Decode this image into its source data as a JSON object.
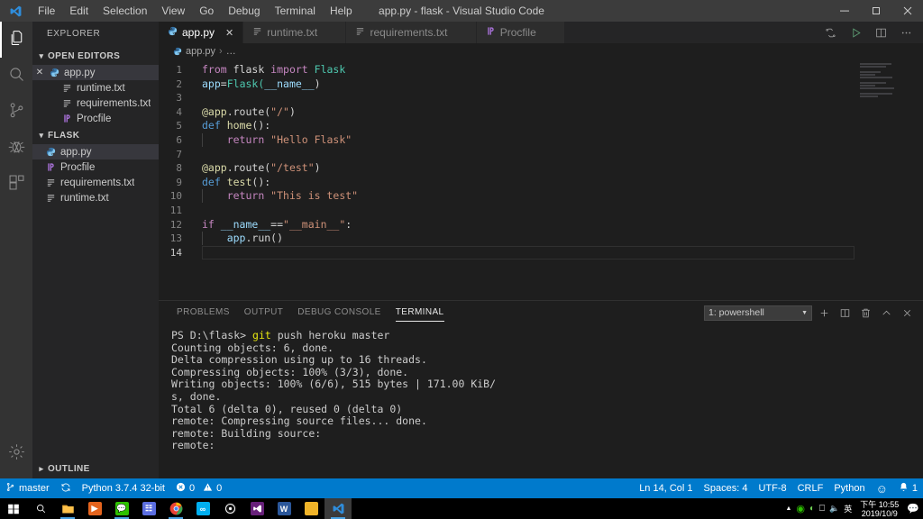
{
  "window": {
    "title": "app.py - flask - Visual Studio Code",
    "minimize_label": "─",
    "maximize_label": "❐",
    "close_label": "✕"
  },
  "menubar": {
    "items": [
      {
        "label": "File"
      },
      {
        "label": "Edit"
      },
      {
        "label": "Selection"
      },
      {
        "label": "View"
      },
      {
        "label": "Go"
      },
      {
        "label": "Debug"
      },
      {
        "label": "Terminal"
      },
      {
        "label": "Help"
      }
    ]
  },
  "activitybar": {
    "items": [
      {
        "name": "explorer",
        "icon": "files-icon",
        "active": true
      },
      {
        "name": "search",
        "icon": "search-icon",
        "active": false
      },
      {
        "name": "source-control",
        "icon": "source-control-icon",
        "active": false
      },
      {
        "name": "debug",
        "icon": "debug-icon",
        "active": false
      },
      {
        "name": "extensions",
        "icon": "extensions-icon",
        "active": false
      }
    ],
    "settings_icon": "gear-icon"
  },
  "sidebar": {
    "title": "EXPLORER",
    "open_editors": {
      "header": "OPEN EDITORS",
      "items": [
        {
          "label": "app.py",
          "icon": "python-icon",
          "selected": true,
          "has_close": true,
          "indent": 0
        },
        {
          "label": "runtime.txt",
          "icon": "text-icon",
          "selected": false,
          "has_close": false,
          "indent": 1
        },
        {
          "label": "requirements.txt",
          "icon": "text-icon",
          "selected": false,
          "has_close": false,
          "indent": 1
        },
        {
          "label": "Procfile",
          "icon": "procfile-icon",
          "selected": false,
          "has_close": false,
          "indent": 1
        }
      ]
    },
    "folder": {
      "header": "FLASK",
      "items": [
        {
          "label": "app.py",
          "icon": "python-icon",
          "selected": true
        },
        {
          "label": "Procfile",
          "icon": "procfile-icon",
          "selected": false
        },
        {
          "label": "requirements.txt",
          "icon": "text-icon",
          "selected": false
        },
        {
          "label": "runtime.txt",
          "icon": "text-icon",
          "selected": false
        }
      ]
    },
    "outline": {
      "header": "OUTLINE"
    }
  },
  "editor": {
    "tabs": [
      {
        "label": "app.py",
        "icon": "python-icon",
        "active": true
      },
      {
        "label": "runtime.txt",
        "icon": "text-icon",
        "active": false
      },
      {
        "label": "requirements.txt",
        "icon": "text-icon",
        "active": false
      },
      {
        "label": "Procfile",
        "icon": "procfile-icon",
        "active": false
      }
    ],
    "tab_close_label": "✕",
    "actions": [
      {
        "name": "run-tests-icon",
        "glyph": "⇅"
      },
      {
        "name": "run-python-file-icon",
        "glyph": "▷"
      },
      {
        "name": "split-editor-icon",
        "glyph": "▯"
      },
      {
        "name": "more-actions-icon",
        "glyph": "…"
      }
    ],
    "breadcrumb": {
      "file": "app.py",
      "separator": "›",
      "rest": "…"
    },
    "active_line": 14,
    "lines": [
      {
        "n": 1,
        "tokens": [
          {
            "t": "from ",
            "c": "t-kw2"
          },
          {
            "t": "flask ",
            "c": "t-plain"
          },
          {
            "t": "import ",
            "c": "t-kw2"
          },
          {
            "t": "Flask",
            "c": "t-cls"
          }
        ]
      },
      {
        "n": 2,
        "tokens": [
          {
            "t": "app",
            "c": "t-var"
          },
          {
            "t": "=",
            "c": "t-punc"
          },
          {
            "t": "Flask(",
            "c": "t-cls"
          },
          {
            "t": "__name__",
            "c": "t-var"
          },
          {
            "t": ")",
            "c": "t-punc"
          }
        ]
      },
      {
        "n": 3,
        "tokens": []
      },
      {
        "n": 4,
        "tokens": [
          {
            "t": "@app",
            "c": "t-deco"
          },
          {
            "t": ".route(",
            "c": "t-plain"
          },
          {
            "t": "\"/\"",
            "c": "t-str"
          },
          {
            "t": ")",
            "c": "t-punc"
          }
        ]
      },
      {
        "n": 5,
        "tokens": [
          {
            "t": "def ",
            "c": "t-kw"
          },
          {
            "t": "home",
            "c": "t-fn"
          },
          {
            "t": "():",
            "c": "t-punc"
          }
        ]
      },
      {
        "n": 6,
        "indent": true,
        "tokens": [
          {
            "t": "    ",
            "c": "t-plain"
          },
          {
            "t": "return ",
            "c": "t-kw2"
          },
          {
            "t": "\"Hello Flask\"",
            "c": "t-str"
          }
        ]
      },
      {
        "n": 7,
        "tokens": []
      },
      {
        "n": 8,
        "tokens": [
          {
            "t": "@app",
            "c": "t-deco"
          },
          {
            "t": ".route(",
            "c": "t-plain"
          },
          {
            "t": "\"/test\"",
            "c": "t-str"
          },
          {
            "t": ")",
            "c": "t-punc"
          }
        ]
      },
      {
        "n": 9,
        "tokens": [
          {
            "t": "def ",
            "c": "t-kw"
          },
          {
            "t": "test",
            "c": "t-fn"
          },
          {
            "t": "():",
            "c": "t-punc"
          }
        ]
      },
      {
        "n": 10,
        "indent": true,
        "tokens": [
          {
            "t": "    ",
            "c": "t-plain"
          },
          {
            "t": "return ",
            "c": "t-kw2"
          },
          {
            "t": "\"This is test\"",
            "c": "t-str"
          }
        ]
      },
      {
        "n": 11,
        "tokens": []
      },
      {
        "n": 12,
        "tokens": [
          {
            "t": "if ",
            "c": "t-kw2"
          },
          {
            "t": "__name__",
            "c": "t-var"
          },
          {
            "t": "==",
            "c": "t-punc"
          },
          {
            "t": "\"__main__\"",
            "c": "t-str"
          },
          {
            "t": ":",
            "c": "t-punc"
          }
        ]
      },
      {
        "n": 13,
        "indent": true,
        "tokens": [
          {
            "t": "    ",
            "c": "t-plain"
          },
          {
            "t": "app",
            "c": "t-var"
          },
          {
            "t": ".run()",
            "c": "t-plain"
          }
        ]
      },
      {
        "n": 14,
        "tokens": []
      }
    ]
  },
  "panel": {
    "tabs": [
      {
        "label": "PROBLEMS",
        "active": false
      },
      {
        "label": "OUTPUT",
        "active": false
      },
      {
        "label": "DEBUG CONSOLE",
        "active": false
      },
      {
        "label": "TERMINAL",
        "active": true
      }
    ],
    "terminal_select": {
      "value": "1: powershell",
      "caret": "▼"
    },
    "actions": [
      {
        "name": "new-terminal-icon",
        "glyph": "+"
      },
      {
        "name": "split-terminal-icon",
        "glyph": "▯"
      },
      {
        "name": "kill-terminal-icon",
        "glyph": "Ὕ1"
      },
      {
        "name": "maximize-panel-icon",
        "glyph": "⌃"
      },
      {
        "name": "close-panel-icon",
        "glyph": "✕"
      }
    ],
    "terminal_lines": [
      {
        "segments": [
          {
            "t": "PS D:\\flask> ",
            "c": ""
          },
          {
            "t": "git",
            "c": "tm-yellow"
          },
          {
            "t": " push heroku master",
            "c": ""
          }
        ]
      },
      {
        "segments": [
          {
            "t": "Counting objects: 6, done.",
            "c": ""
          }
        ]
      },
      {
        "segments": [
          {
            "t": "Delta compression using up to 16 threads.",
            "c": ""
          }
        ]
      },
      {
        "segments": [
          {
            "t": "Compressing objects: 100% (3/3), done.",
            "c": ""
          }
        ]
      },
      {
        "segments": [
          {
            "t": "Writing objects: 100% (6/6), 515 bytes | 171.00 KiB/",
            "c": ""
          }
        ]
      },
      {
        "segments": [
          {
            "t": "s, done.",
            "c": ""
          }
        ]
      },
      {
        "segments": [
          {
            "t": "Total 6 (delta 0), reused 0 (delta 0)",
            "c": ""
          }
        ]
      },
      {
        "segments": [
          {
            "t": "remote: Compressing source files... done.",
            "c": ""
          }
        ]
      },
      {
        "segments": [
          {
            "t": "remote: Building source:",
            "c": ""
          }
        ]
      },
      {
        "segments": [
          {
            "t": "remote:",
            "c": ""
          }
        ]
      }
    ]
  },
  "statusbar": {
    "background": "#007acc",
    "left": [
      {
        "name": "branch",
        "icon": "source-control-icon",
        "label": "master"
      },
      {
        "name": "sync",
        "icon": "sync-icon",
        "label": ""
      },
      {
        "name": "python-interpreter",
        "icon": "",
        "label": "Python 3.7.4 32-bit"
      },
      {
        "name": "problems",
        "icon": "error-icon",
        "label": "0",
        "icon2": "warning-icon",
        "label2": "0"
      }
    ],
    "right": [
      {
        "name": "cursor-position",
        "label": "Ln 14, Col 1"
      },
      {
        "name": "indentation",
        "label": "Spaces: 4"
      },
      {
        "name": "encoding",
        "label": "UTF-8"
      },
      {
        "name": "eol",
        "label": "CRLF"
      },
      {
        "name": "language-mode",
        "label": "Python"
      },
      {
        "name": "feedback",
        "label": "☺"
      },
      {
        "name": "notifications",
        "label": "1"
      }
    ]
  },
  "taskbar": {
    "start": {
      "name": "start-button"
    },
    "search": {
      "name": "search-icon"
    },
    "apps": [
      {
        "name": "file-explorer-icon",
        "color": "#ffb43c",
        "glyph": "",
        "running": true,
        "focus": false
      },
      {
        "name": "media-player-icon",
        "color": "#e4641e",
        "glyph": "▶",
        "running": false,
        "focus": false
      },
      {
        "name": "wechat-icon",
        "color": "#2dc100",
        "glyph": "●",
        "running": true,
        "focus": false
      },
      {
        "name": "messenger-icon",
        "color": "#5865f2",
        "glyph": "",
        "running": false,
        "focus": false
      },
      {
        "name": "chrome-icon",
        "color": "#4285f4",
        "glyph": "",
        "running": true,
        "focus": false
      },
      {
        "name": "skype-icon",
        "color": "#00aff0",
        "glyph": "∞",
        "running": false,
        "focus": false
      },
      {
        "name": "disc-icon",
        "color": "#111111",
        "glyph": "◎",
        "running": false,
        "focus": false
      },
      {
        "name": "vs-icon",
        "color": "#68217a",
        "glyph": "❖",
        "running": false,
        "focus": false
      },
      {
        "name": "word-icon",
        "color": "#2b579a",
        "glyph": "W",
        "running": false,
        "focus": false
      },
      {
        "name": "notepad-icon",
        "color": "#f0b429",
        "glyph": "",
        "running": false,
        "focus": false
      },
      {
        "name": "vscode-icon",
        "color": "#0066b8",
        "glyph": "",
        "running": true,
        "focus": true
      }
    ],
    "tray": {
      "items": [
        {
          "name": "tray-up-icon",
          "glyph": "▲"
        },
        {
          "name": "tray-wechat-icon",
          "glyph": "●"
        },
        {
          "name": "tray-network-icon",
          "glyph": "⚬"
        },
        {
          "name": "tray-display-icon",
          "glyph": "▭"
        },
        {
          "name": "tray-volume-icon",
          "glyph": "◂)"
        },
        {
          "name": "tray-ime-icon",
          "glyph": "英"
        }
      ],
      "clock_time": "下午 10:55",
      "clock_date": "2019/10/9",
      "action_center": {
        "name": "action-center-icon",
        "glyph": "❐"
      }
    }
  }
}
